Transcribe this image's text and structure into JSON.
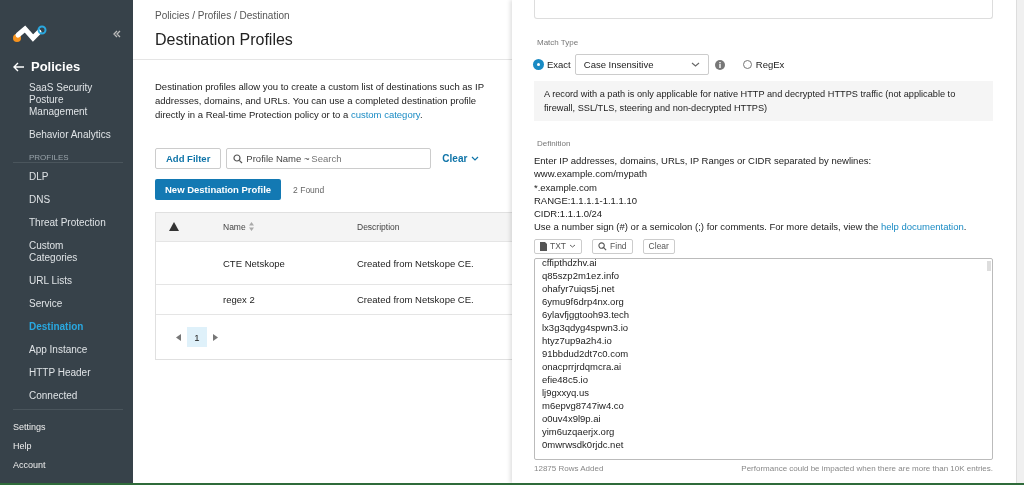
{
  "sidebar": {
    "back_label": "Policies",
    "items": [
      {
        "label": "SaaS Security Posture Management",
        "selected": false
      },
      {
        "label": "Behavior Analytics",
        "selected": false
      }
    ],
    "section": "PROFILES",
    "profile_items": [
      {
        "label": "DLP",
        "selected": false
      },
      {
        "label": "DNS",
        "selected": false
      },
      {
        "label": "Threat Protection",
        "selected": false
      },
      {
        "label": "Custom Categories",
        "selected": false
      },
      {
        "label": "URL Lists",
        "selected": false
      },
      {
        "label": "Service",
        "selected": false
      },
      {
        "label": "Destination",
        "selected": true
      },
      {
        "label": "App Instance",
        "selected": false
      },
      {
        "label": "HTTP Header",
        "selected": false
      },
      {
        "label": "Connected",
        "selected": false
      }
    ],
    "footer": [
      "Settings",
      "Help",
      "Account"
    ]
  },
  "main": {
    "breadcrumb": "Policies / Profiles / Destination",
    "title": "Destination Profiles",
    "description": "Destination profiles allow you to create a custom list of destinations such as IP addresses, domains, and URLs. You can use a completed destination profile directly in a Real-time Protection policy or to a ",
    "description_link": "custom category",
    "description_end": ".",
    "add_filter": "Add Filter",
    "search": {
      "label": "Profile Name ~",
      "placeholder": "Search"
    },
    "clear": "Clear",
    "new_button": "New Destination Profile",
    "found": "2 Found",
    "table": {
      "columns": [
        "Name",
        "Description"
      ],
      "rows": [
        {
          "name": "CTE Netskope",
          "description": "Created from Netskope CE."
        },
        {
          "name": "regex 2",
          "description": "Created from Netskope CE."
        }
      ]
    },
    "pagination": [
      {
        "label": "1",
        "selected": true
      }
    ]
  },
  "panel": {
    "match_type_label": "Match Type",
    "radios": [
      {
        "label": "Exact",
        "selected": true
      },
      {
        "label": "RegEx",
        "selected": false
      }
    ],
    "case_select": "Case Insensitive",
    "note": "A record with a path is only applicable for native HTTP and decrypted HTTPS traffic (not applicable to firewall, SSL/TLS, steering and non-decrypted HTTPS)",
    "definition_label": "Definition",
    "instructions": [
      "Enter IP addresses, domains, URLs, IP Ranges or CIDR separated by newlines:",
      "www.example.com/mypath",
      "*.example.com",
      "RANGE:1.1.1.1-1.1.1.10",
      "CIDR:1.1.1.0/24"
    ],
    "comment_hint": "Use a number sign (#) or a semicolon (;) for comments. For more details, view the ",
    "help_link": "help documentation",
    "comment_end": ".",
    "format_button": "TXT",
    "find_button": "Find",
    "clear_button": "Clear",
    "entries": [
      "cffipthdzhv.ai",
      "q85szp2m1ez.info",
      "ohafyr7uiqs5j.net",
      "6ymu9f6drp4nx.org",
      "6ylavfjggtooh93.tech",
      "lx3g3qdyg4spwn3.io",
      "htyz7up9a2h4.io",
      "91bbdud2dt7c0.com",
      "onacprrjrdqmcra.ai",
      "efie48c5.io",
      "lj9gxxyq.us",
      "m6epvg8747iw4.co",
      "o0uv4x9l9p.ai",
      "yim6uzqaerjx.org",
      "0mwrwsdk0rjdc.net"
    ],
    "rows_added": "12875 Rows Added",
    "warning": "Performance could be impacted when there are more than 10K entries."
  }
}
